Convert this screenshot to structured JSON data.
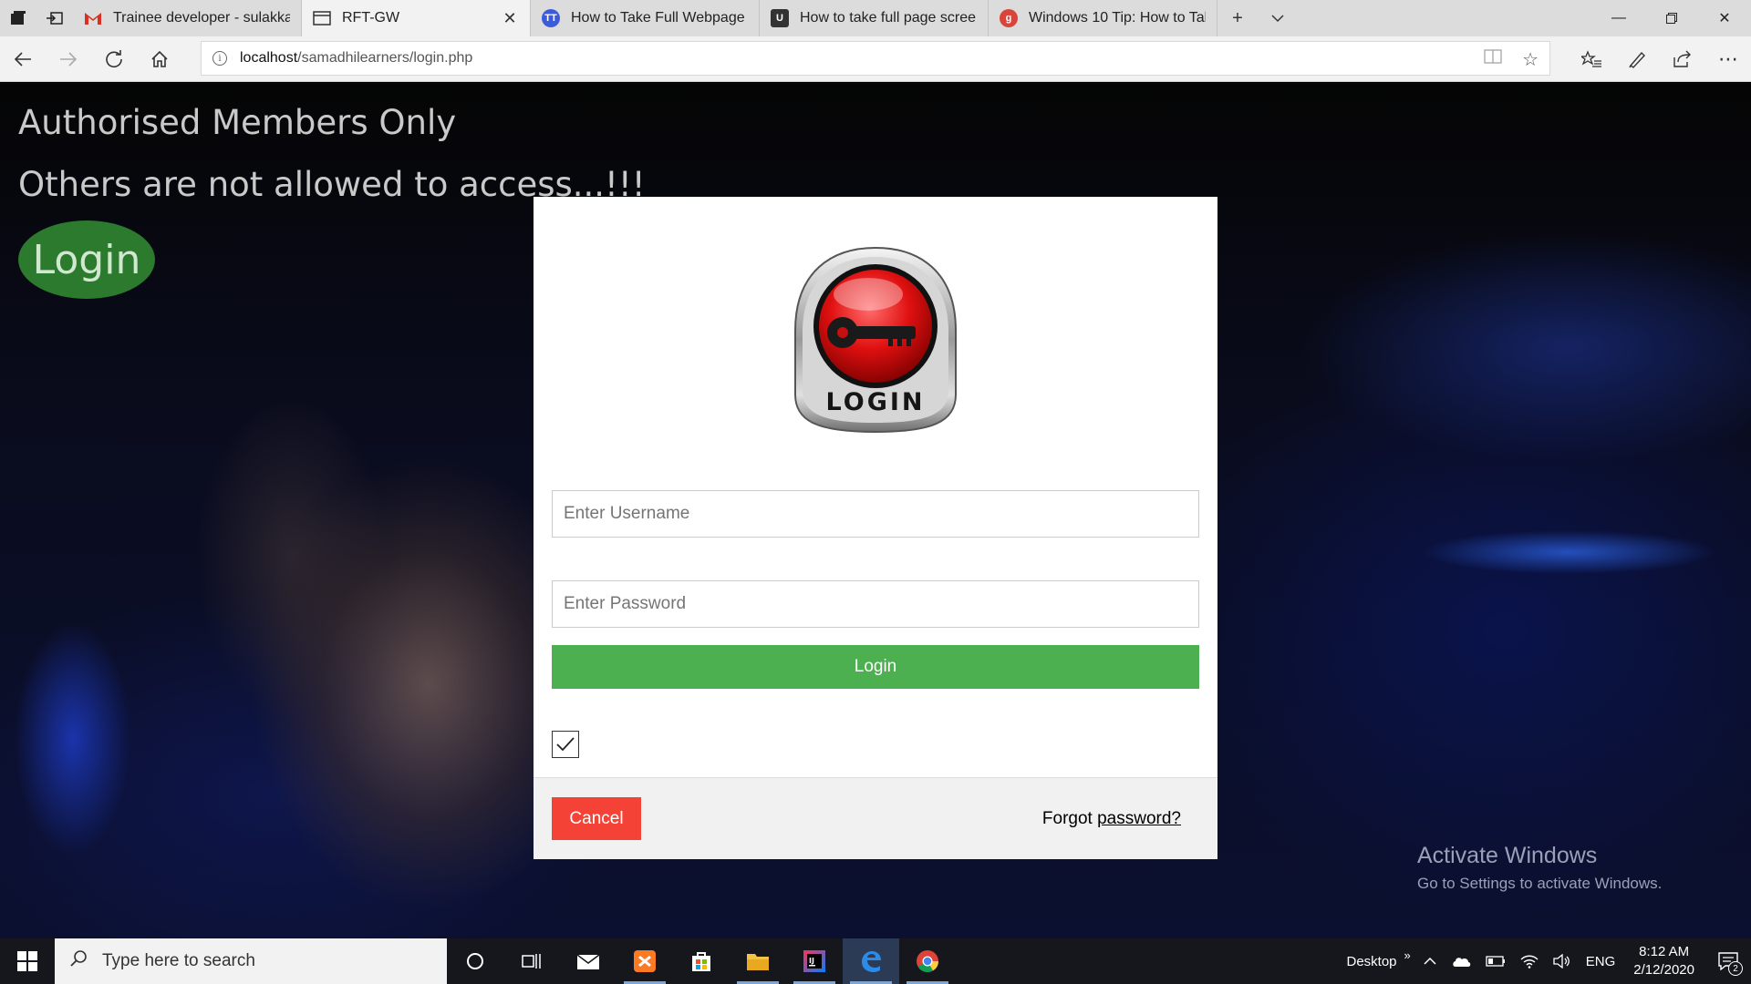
{
  "browser": {
    "tabs": [
      {
        "title": "Trainee developer - sulakkai",
        "favicon": "gmail-icon",
        "active": false
      },
      {
        "title": "RFT-GW",
        "favicon": "page-icon",
        "active": true
      },
      {
        "title": "How to Take Full Webpage :",
        "favicon": "tt-icon",
        "active": false
      },
      {
        "title": "How to take full page screen",
        "favicon": "u-icon",
        "active": false
      },
      {
        "title": "Windows 10 Tip: How to Tal",
        "favicon": "g-icon",
        "active": false
      }
    ],
    "address": {
      "host": "localhost",
      "path": "/samadhilearners/login.php"
    }
  },
  "page": {
    "heading1": "Authorised Members Only",
    "heading2": "Others are not allowed to access...!!!",
    "login_button": "Login"
  },
  "modal": {
    "logo_text": "LOGIN",
    "username_placeholder": "Enter Username",
    "password_placeholder": "Enter Password",
    "login_label": "Login",
    "remember_checked": true,
    "cancel_label": "Cancel",
    "forgot_prefix": "Forgot ",
    "forgot_link": "password?"
  },
  "watermark": {
    "line1": "Activate Windows",
    "line2": "Go to Settings to activate Windows."
  },
  "taskbar": {
    "search_placeholder": "Type here to search",
    "desktop_label": "Desktop",
    "language": "ENG",
    "time": "8:12 AM",
    "date": "2/12/2020",
    "notification_count": "2"
  },
  "colors": {
    "login_green": "#4caf50",
    "cancel_red": "#f44336",
    "bg_login_green": "#2c7a2e"
  }
}
